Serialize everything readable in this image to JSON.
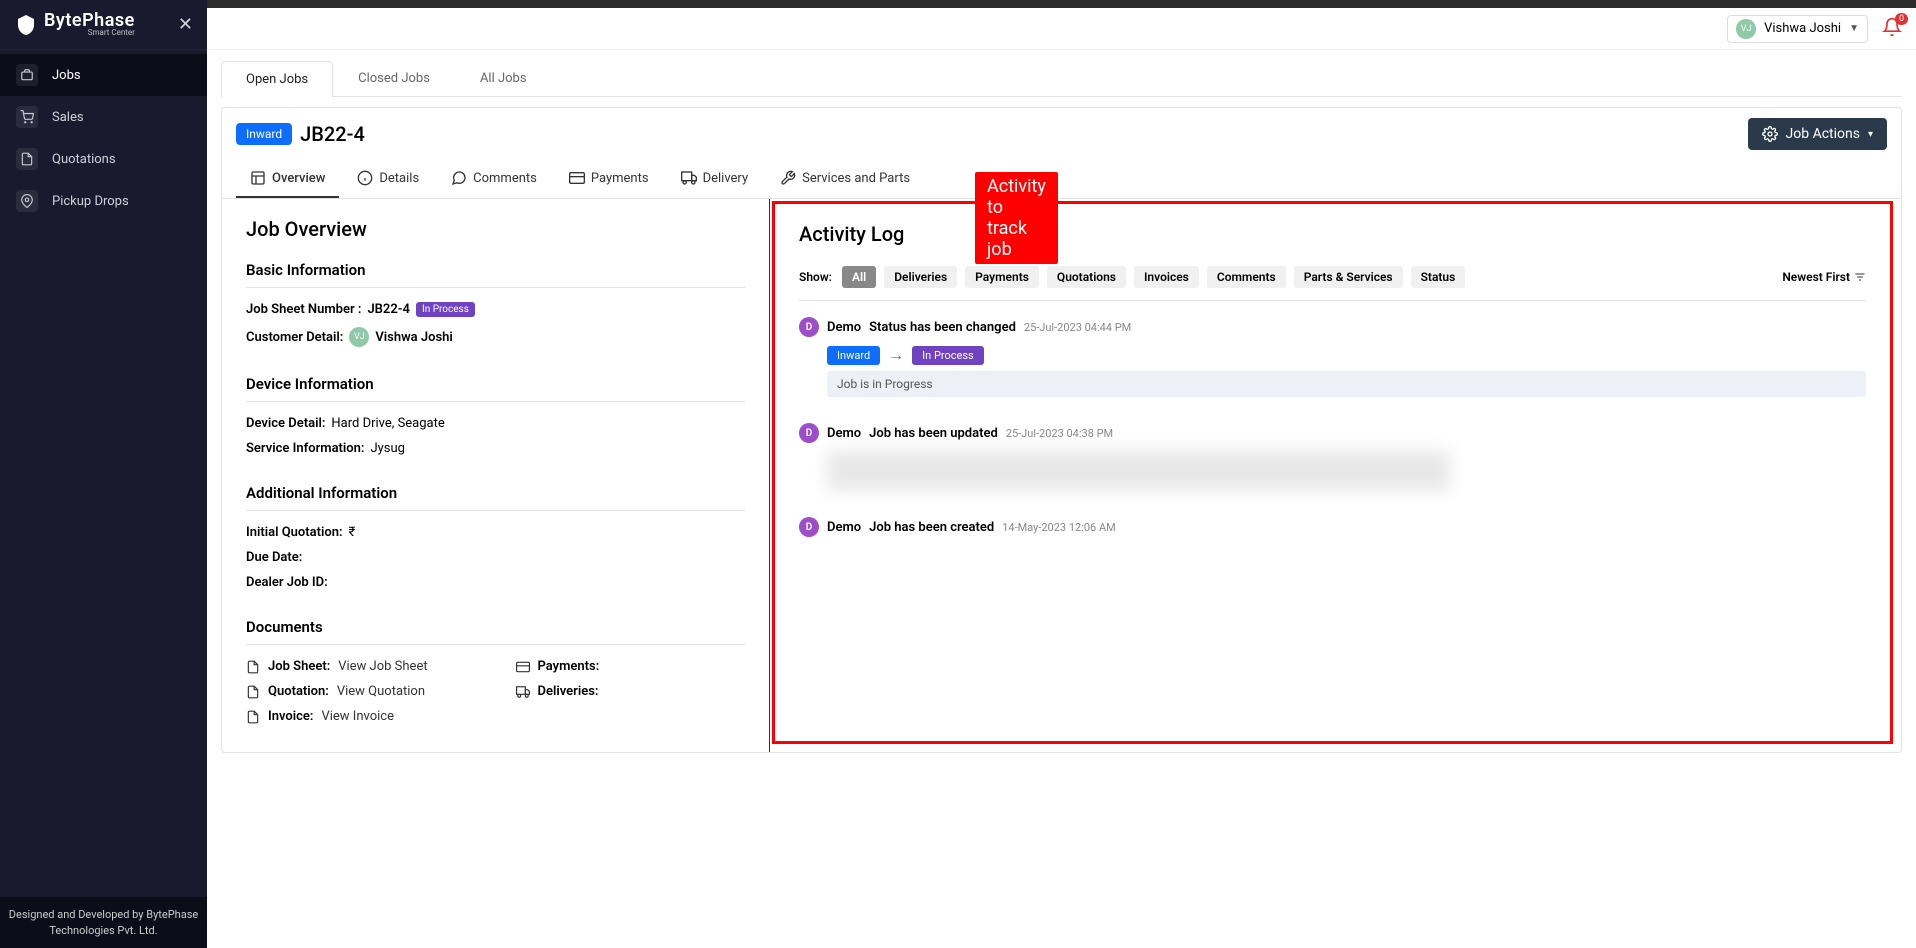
{
  "brand": {
    "name": "BytePhase",
    "subtitle": "Smart Center"
  },
  "sidebar": {
    "close": "✕",
    "items": [
      {
        "label": "Jobs"
      },
      {
        "label": "Sales"
      },
      {
        "label": "Quotations"
      },
      {
        "label": "Pickup Drops"
      }
    ],
    "footer": "Designed and Developed by BytePhase Technologies Pvt. Ltd."
  },
  "topbar": {
    "user_initials": "VJ",
    "user_name": "Vishwa Joshi",
    "notif_count": "0"
  },
  "tabs": [
    {
      "label": "Open Jobs"
    },
    {
      "label": "Closed Jobs"
    },
    {
      "label": "All Jobs"
    }
  ],
  "job": {
    "badge": "Inward",
    "id": "JB22-4",
    "actions_label": "Job Actions"
  },
  "subtabs": [
    {
      "label": "Overview"
    },
    {
      "label": "Details"
    },
    {
      "label": "Comments"
    },
    {
      "label": "Payments"
    },
    {
      "label": "Delivery"
    },
    {
      "label": "Services and Parts"
    }
  ],
  "callout": "Activity to track job",
  "overview": {
    "title": "Job Overview",
    "basic_heading": "Basic Information",
    "sheet_label": "Job Sheet Number :",
    "sheet_value": "JB22-4",
    "status_pill": "In Process",
    "customer_label": "Customer Detail:",
    "customer_initials": "VJ",
    "customer_name": "Vishwa Joshi",
    "device_heading": "Device Information",
    "device_label": "Device Detail:",
    "device_value": "Hard Drive, Seagate",
    "service_label": "Service Information:",
    "service_value": "Jysug",
    "additional_heading": "Additional Information",
    "quote_label": "Initial Quotation:",
    "quote_value": "₹",
    "due_label": "Due Date:",
    "due_value": "",
    "dealer_label": "Dealer Job ID:",
    "dealer_value": "",
    "docs_heading": "Documents",
    "docs": {
      "jobsheet_label": "Job Sheet:",
      "jobsheet_link": "View Job Sheet",
      "quotation_label": "Quotation:",
      "quotation_link": "View Quotation",
      "invoice_label": "Invoice:",
      "invoice_link": "View Invoice",
      "payments_label": "Payments:",
      "deliveries_label": "Deliveries:"
    }
  },
  "activity": {
    "title": "Activity Log",
    "show_label": "Show:",
    "filters": [
      "All",
      "Deliveries",
      "Payments",
      "Quotations",
      "Invoices",
      "Comments",
      "Parts & Services",
      "Status"
    ],
    "sort": "Newest First",
    "entries": [
      {
        "avatar": "D",
        "user": "Demo",
        "action": "Status has been changed",
        "time": "25-Jul-2023 04:44 PM",
        "from": "Inward",
        "to": "In Process",
        "note": "Job is in Progress"
      },
      {
        "avatar": "D",
        "user": "Demo",
        "action": "Job has been updated",
        "time": "25-Jul-2023 04:38 PM"
      },
      {
        "avatar": "D",
        "user": "Demo",
        "action": "Job has been created",
        "time": "14-May-2023 12:06 AM"
      }
    ]
  }
}
